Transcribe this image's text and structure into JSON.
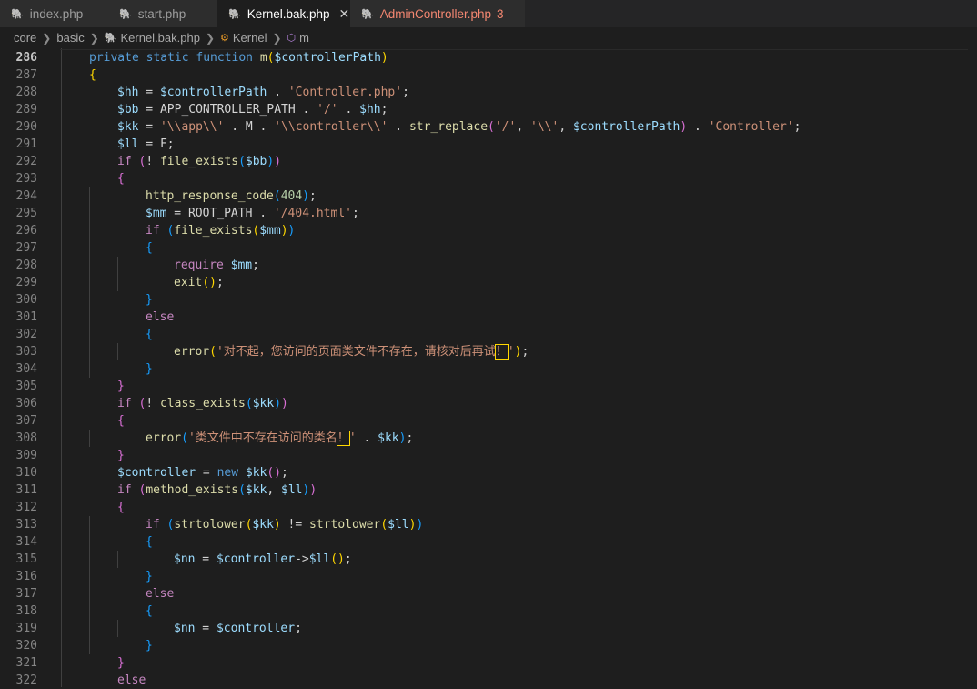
{
  "tabs": [
    {
      "label": "index.php",
      "active": false
    },
    {
      "label": "start.php",
      "active": false
    },
    {
      "label": "Kernel.bak.php",
      "active": true,
      "close": "✕"
    },
    {
      "label": "AdminController.php",
      "active": false,
      "badge": "3"
    }
  ],
  "breadcrumb": {
    "items": [
      "core",
      "basic",
      "Kernel.bak.php",
      "Kernel",
      "m"
    ]
  },
  "editor": {
    "current_line": "286",
    "lines": [
      {
        "no": "286",
        "indent": 0,
        "tokens": [
          [
            "k",
            "private static function "
          ],
          [
            "f",
            "m"
          ],
          [
            "p",
            "("
          ],
          [
            "v",
            "$controllerPath"
          ],
          [
            "p",
            ")"
          ]
        ]
      },
      {
        "no": "287",
        "indent": 0,
        "tokens": [
          [
            "p",
            "{"
          ]
        ]
      },
      {
        "no": "288",
        "indent": 1,
        "tokens": [
          [
            "v",
            "$hh"
          ],
          [
            "t",
            " = "
          ],
          [
            "v",
            "$controllerPath"
          ],
          [
            "t",
            " . "
          ],
          [
            "s",
            "'Controller.php'"
          ],
          [
            "t",
            ";"
          ]
        ]
      },
      {
        "no": "289",
        "indent": 1,
        "tokens": [
          [
            "v",
            "$bb"
          ],
          [
            "t",
            " = APP_CONTROLLER_PATH . "
          ],
          [
            "s",
            "'/'"
          ],
          [
            "t",
            " . "
          ],
          [
            "v",
            "$hh"
          ],
          [
            "t",
            ";"
          ]
        ]
      },
      {
        "no": "290",
        "indent": 1,
        "tokens": [
          [
            "v",
            "$kk"
          ],
          [
            "t",
            " = "
          ],
          [
            "s",
            "'\\\\app\\\\'"
          ],
          [
            "t",
            " . M . "
          ],
          [
            "s",
            "'\\\\controller\\\\'"
          ],
          [
            "t",
            " . "
          ],
          [
            "f",
            "str_replace"
          ],
          [
            "p2",
            "("
          ],
          [
            "s",
            "'/'"
          ],
          [
            "t",
            ", "
          ],
          [
            "s",
            "'\\\\'"
          ],
          [
            "t",
            ", "
          ],
          [
            "v",
            "$controllerPath"
          ],
          [
            "p2",
            ")"
          ],
          [
            "t",
            " . "
          ],
          [
            "s",
            "'Controller'"
          ],
          [
            "t",
            ";"
          ]
        ]
      },
      {
        "no": "291",
        "indent": 1,
        "tokens": [
          [
            "v",
            "$ll"
          ],
          [
            "t",
            " = F;"
          ]
        ]
      },
      {
        "no": "292",
        "indent": 1,
        "tokens": [
          [
            "c",
            "if "
          ],
          [
            "p2",
            "("
          ],
          [
            "t",
            "! "
          ],
          [
            "f",
            "file_exists"
          ],
          [
            "p3",
            "("
          ],
          [
            "v",
            "$bb"
          ],
          [
            "p3",
            ")"
          ],
          [
            "p2",
            ")"
          ]
        ]
      },
      {
        "no": "293",
        "indent": 1,
        "tokens": [
          [
            "p2",
            "{"
          ]
        ]
      },
      {
        "no": "294",
        "indent": 2,
        "tokens": [
          [
            "f",
            "http_response_code"
          ],
          [
            "p3",
            "("
          ],
          [
            "n",
            "404"
          ],
          [
            "p3",
            ")"
          ],
          [
            "t",
            ";"
          ]
        ]
      },
      {
        "no": "295",
        "indent": 2,
        "tokens": [
          [
            "v",
            "$mm"
          ],
          [
            "t",
            " = ROOT_PATH . "
          ],
          [
            "s",
            "'/404.html'"
          ],
          [
            "t",
            ";"
          ]
        ]
      },
      {
        "no": "296",
        "indent": 2,
        "tokens": [
          [
            "c",
            "if "
          ],
          [
            "p3",
            "("
          ],
          [
            "f",
            "file_exists"
          ],
          [
            "p",
            "("
          ],
          [
            "v",
            "$mm"
          ],
          [
            "p",
            ")"
          ],
          [
            "p3",
            ")"
          ]
        ]
      },
      {
        "no": "297",
        "indent": 2,
        "tokens": [
          [
            "p3",
            "{"
          ]
        ]
      },
      {
        "no": "298",
        "indent": 3,
        "tokens": [
          [
            "c",
            "require "
          ],
          [
            "v",
            "$mm"
          ],
          [
            "t",
            ";"
          ]
        ]
      },
      {
        "no": "299",
        "indent": 3,
        "tokens": [
          [
            "f",
            "exit"
          ],
          [
            "p",
            "()"
          ],
          [
            "t",
            ";"
          ]
        ]
      },
      {
        "no": "300",
        "indent": 2,
        "tokens": [
          [
            "p3",
            "}"
          ]
        ]
      },
      {
        "no": "301",
        "indent": 2,
        "tokens": [
          [
            "c",
            "else"
          ]
        ]
      },
      {
        "no": "302",
        "indent": 2,
        "tokens": [
          [
            "p3",
            "{"
          ]
        ]
      },
      {
        "no": "303",
        "indent": 3,
        "tokens": [
          [
            "f",
            "error"
          ],
          [
            "p",
            "("
          ],
          [
            "s",
            "'对不起，您访问的页面类文件不存在，请核对后再试"
          ],
          [
            "s hl",
            "！"
          ],
          [
            "s",
            "'"
          ],
          [
            "p",
            ")"
          ],
          [
            "t",
            ";"
          ]
        ]
      },
      {
        "no": "304",
        "indent": 2,
        "tokens": [
          [
            "p3",
            "}"
          ]
        ]
      },
      {
        "no": "305",
        "indent": 1,
        "tokens": [
          [
            "p2",
            "}"
          ]
        ]
      },
      {
        "no": "306",
        "indent": 1,
        "tokens": [
          [
            "c",
            "if "
          ],
          [
            "p2",
            "("
          ],
          [
            "t",
            "! "
          ],
          [
            "f",
            "class_exists"
          ],
          [
            "p3",
            "("
          ],
          [
            "v",
            "$kk"
          ],
          [
            "p3",
            ")"
          ],
          [
            "p2",
            ")"
          ]
        ]
      },
      {
        "no": "307",
        "indent": 1,
        "tokens": [
          [
            "p2",
            "{"
          ]
        ]
      },
      {
        "no": "308",
        "indent": 2,
        "tokens": [
          [
            "f",
            "error"
          ],
          [
            "p3",
            "("
          ],
          [
            "s",
            "'类文件中不存在访问的类名"
          ],
          [
            "s hl",
            "！"
          ],
          [
            "s",
            "'"
          ],
          [
            "t",
            " . "
          ],
          [
            "v",
            "$kk"
          ],
          [
            "p3",
            ")"
          ],
          [
            "t",
            ";"
          ]
        ]
      },
      {
        "no": "309",
        "indent": 1,
        "tokens": [
          [
            "p2",
            "}"
          ]
        ]
      },
      {
        "no": "310",
        "indent": 1,
        "tokens": [
          [
            "v",
            "$controller"
          ],
          [
            "t",
            " = "
          ],
          [
            "k",
            "new "
          ],
          [
            "v",
            "$kk"
          ],
          [
            "p2",
            "()"
          ],
          [
            "t",
            ";"
          ]
        ]
      },
      {
        "no": "311",
        "indent": 1,
        "tokens": [
          [
            "c",
            "if "
          ],
          [
            "p2",
            "("
          ],
          [
            "f",
            "method_exists"
          ],
          [
            "p3",
            "("
          ],
          [
            "v",
            "$kk"
          ],
          [
            "t",
            ", "
          ],
          [
            "v",
            "$ll"
          ],
          [
            "p3",
            ")"
          ],
          [
            "p2",
            ")"
          ]
        ]
      },
      {
        "no": "312",
        "indent": 1,
        "tokens": [
          [
            "p2",
            "{"
          ]
        ]
      },
      {
        "no": "313",
        "indent": 2,
        "tokens": [
          [
            "c",
            "if "
          ],
          [
            "p3",
            "("
          ],
          [
            "f",
            "strtolower"
          ],
          [
            "p",
            "("
          ],
          [
            "v",
            "$kk"
          ],
          [
            "p",
            ")"
          ],
          [
            "t",
            " != "
          ],
          [
            "f",
            "strtolower"
          ],
          [
            "p",
            "("
          ],
          [
            "v",
            "$ll"
          ],
          [
            "p",
            ")"
          ],
          [
            "p3",
            ")"
          ]
        ]
      },
      {
        "no": "314",
        "indent": 2,
        "tokens": [
          [
            "p3",
            "{"
          ]
        ]
      },
      {
        "no": "315",
        "indent": 3,
        "tokens": [
          [
            "v",
            "$nn"
          ],
          [
            "t",
            " = "
          ],
          [
            "v",
            "$controller"
          ],
          [
            "t",
            "->"
          ],
          [
            "v",
            "$ll"
          ],
          [
            "p",
            "()"
          ],
          [
            "t",
            ";"
          ]
        ]
      },
      {
        "no": "316",
        "indent": 2,
        "tokens": [
          [
            "p3",
            "}"
          ]
        ]
      },
      {
        "no": "317",
        "indent": 2,
        "tokens": [
          [
            "c",
            "else"
          ]
        ]
      },
      {
        "no": "318",
        "indent": 2,
        "tokens": [
          [
            "p3",
            "{"
          ]
        ]
      },
      {
        "no": "319",
        "indent": 3,
        "tokens": [
          [
            "v",
            "$nn"
          ],
          [
            "t",
            " = "
          ],
          [
            "v",
            "$controller"
          ],
          [
            "t",
            ";"
          ]
        ]
      },
      {
        "no": "320",
        "indent": 2,
        "tokens": [
          [
            "p3",
            "}"
          ]
        ]
      },
      {
        "no": "321",
        "indent": 1,
        "tokens": [
          [
            "p2",
            "}"
          ]
        ]
      },
      {
        "no": "322",
        "indent": 1,
        "tokens": [
          [
            "c",
            "else"
          ]
        ]
      }
    ]
  },
  "colors": {
    "background": "#1e1e1e",
    "tab_bar": "#252526",
    "error_tab": "#f48771",
    "php_icon": "#a074c4"
  }
}
